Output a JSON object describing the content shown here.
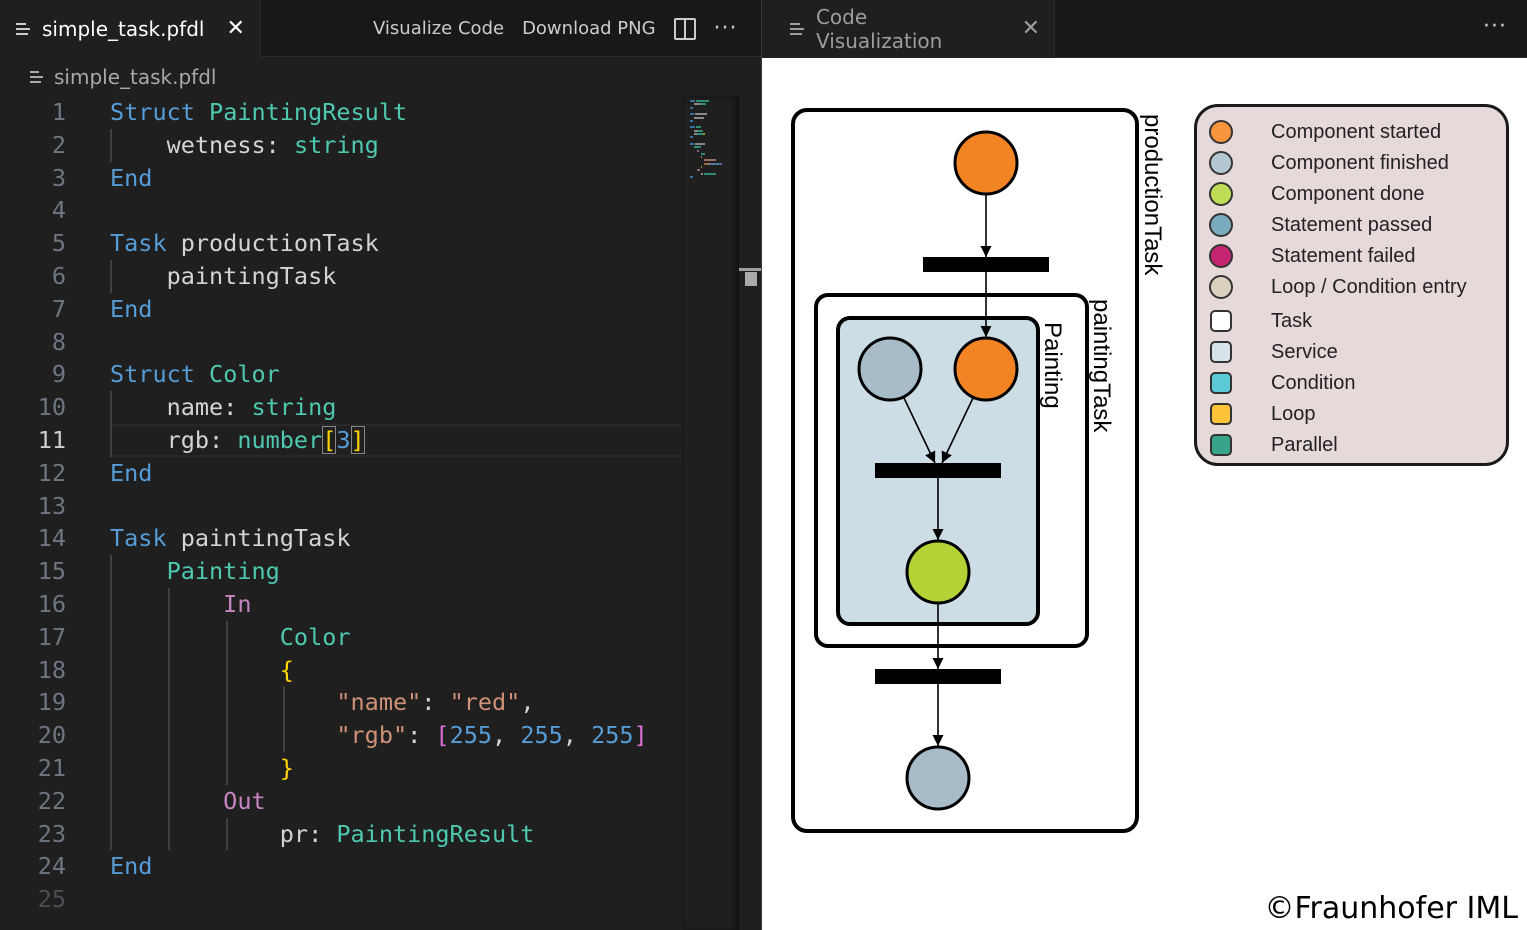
{
  "left_editor": {
    "tab": {
      "label": "simple_task.pfdl",
      "icon": "file-lines-icon",
      "close": "✕"
    },
    "actions": {
      "visualize": "Visualize Code",
      "download": "Download PNG",
      "split_icon": "split-editor-icon",
      "more": "···"
    },
    "breadcrumb": {
      "label": "simple_task.pfdl",
      "icon": "file-lines-icon"
    },
    "current_line": 11,
    "lines": [
      {
        "n": "1",
        "tokens": [
          [
            "k-blue",
            "Struct"
          ],
          [
            "k-plain",
            " "
          ],
          [
            "k-teal",
            "PaintingResult"
          ]
        ]
      },
      {
        "n": "2",
        "tokens": [
          [
            "k-plain",
            "    wetness: "
          ],
          [
            "k-teal",
            "string"
          ]
        ]
      },
      {
        "n": "3",
        "tokens": [
          [
            "k-blue",
            "End"
          ]
        ]
      },
      {
        "n": "4",
        "tokens": []
      },
      {
        "n": "5",
        "tokens": [
          [
            "k-blue",
            "Task"
          ],
          [
            "k-plain",
            " productionTask"
          ]
        ]
      },
      {
        "n": "6",
        "tokens": [
          [
            "k-plain",
            "    paintingTask"
          ]
        ]
      },
      {
        "n": "7",
        "tokens": [
          [
            "k-blue",
            "End"
          ]
        ]
      },
      {
        "n": "8",
        "tokens": []
      },
      {
        "n": "9",
        "tokens": [
          [
            "k-blue",
            "Struct"
          ],
          [
            "k-plain",
            " "
          ],
          [
            "k-teal",
            "Color"
          ]
        ]
      },
      {
        "n": "10",
        "tokens": [
          [
            "k-plain",
            "    name: "
          ],
          [
            "k-teal",
            "string"
          ]
        ]
      },
      {
        "n": "11",
        "tokens": [
          [
            "k-plain",
            "    rgb: "
          ],
          [
            "k-teal",
            "number"
          ],
          [
            "k-gold bm",
            "["
          ],
          [
            "k-num",
            "3"
          ],
          [
            "k-gold bm",
            "]"
          ]
        ]
      },
      {
        "n": "12",
        "tokens": [
          [
            "k-blue",
            "End"
          ]
        ]
      },
      {
        "n": "13",
        "tokens": []
      },
      {
        "n": "14",
        "tokens": [
          [
            "k-blue",
            "Task"
          ],
          [
            "k-plain",
            " paintingTask"
          ]
        ]
      },
      {
        "n": "15",
        "tokens": [
          [
            "k-teal",
            "    Painting"
          ]
        ]
      },
      {
        "n": "16",
        "tokens": [
          [
            "k-purple",
            "        In"
          ]
        ]
      },
      {
        "n": "17",
        "tokens": [
          [
            "k-teal",
            "            Color"
          ]
        ]
      },
      {
        "n": "18",
        "tokens": [
          [
            "k-gold",
            "            {"
          ]
        ]
      },
      {
        "n": "19",
        "tokens": [
          [
            "k-orange",
            "                \"name\""
          ],
          [
            "k-plain",
            ": "
          ],
          [
            "k-orange",
            "\"red\""
          ],
          [
            "k-plain",
            ","
          ]
        ]
      },
      {
        "n": "20",
        "tokens": [
          [
            "k-orange",
            "                \"rgb\""
          ],
          [
            "k-plain",
            ": "
          ],
          [
            "k-pink",
            "["
          ],
          [
            "k-num",
            "255"
          ],
          [
            "k-plain",
            ", "
          ],
          [
            "k-num",
            "255"
          ],
          [
            "k-plain",
            ", "
          ],
          [
            "k-num",
            "255"
          ],
          [
            "k-pink",
            "]"
          ]
        ]
      },
      {
        "n": "21",
        "tokens": [
          [
            "k-gold",
            "            }"
          ]
        ]
      },
      {
        "n": "22",
        "tokens": [
          [
            "k-purple",
            "        Out"
          ]
        ]
      },
      {
        "n": "23",
        "tokens": [
          [
            "k-plain",
            "            pr: "
          ],
          [
            "k-teal",
            "PaintingResult"
          ]
        ]
      },
      {
        "n": "24",
        "tokens": [
          [
            "k-blue",
            "End"
          ]
        ]
      },
      {
        "n": "25",
        "tokens": []
      }
    ]
  },
  "right_editor": {
    "tab": {
      "label": "Code Visualization",
      "icon": "file-lines-icon",
      "close": "✕"
    },
    "more": "···",
    "diagram": {
      "containers": [
        {
          "name": "productionTask",
          "type": "Task",
          "fill": "#ffffff"
        },
        {
          "name": "paintingTask",
          "type": "Task",
          "fill": "#ffffff"
        },
        {
          "name": "Painting",
          "type": "Service",
          "fill": "#ccdde5"
        }
      ],
      "nodes": [
        {
          "id": "pt-start",
          "state": "Component started",
          "color": "#f38423"
        },
        {
          "id": "paint-finished",
          "state": "Component finished",
          "color": "#a7bbc8"
        },
        {
          "id": "paint-start",
          "state": "Component started",
          "color": "#f38423"
        },
        {
          "id": "paint-done",
          "state": "Component done",
          "color": "#b4d235"
        },
        {
          "id": "pt-end",
          "state": "Component finished",
          "color": "#a7bbc8"
        }
      ]
    },
    "legend": [
      {
        "label": "Component started",
        "shape": "circle",
        "color": "#f7953f"
      },
      {
        "label": "Component finished",
        "shape": "circle",
        "color": "#b3c6d1"
      },
      {
        "label": "Component done",
        "shape": "circle",
        "color": "#bedc56"
      },
      {
        "label": "Statement passed",
        "shape": "circle",
        "color": "#79aabd"
      },
      {
        "label": "Statement failed",
        "shape": "circle",
        "color": "#c42470"
      },
      {
        "label": "Loop / Condition entry",
        "shape": "circle",
        "color": "#d9d1bd"
      },
      {
        "label": "Task",
        "shape": "square",
        "color": "#ffffff"
      },
      {
        "label": "Service",
        "shape": "square",
        "color": "#d6e4ea"
      },
      {
        "label": "Condition",
        "shape": "square",
        "color": "#5bcad6"
      },
      {
        "label": "Loop",
        "shape": "square",
        "color": "#fec338"
      },
      {
        "label": "Parallel",
        "shape": "square",
        "color": "#38a58b"
      }
    ],
    "copyright": "©Fraunhofer IML"
  }
}
